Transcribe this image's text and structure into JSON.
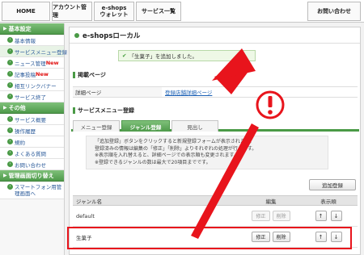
{
  "topnav": {
    "home": "HOME",
    "account": "アカウント管理",
    "eshops_line1": "e-shops",
    "eshops_line2": "ウォレット",
    "service": "サービス一覧",
    "contact": "お問い合わせ"
  },
  "sidebar": {
    "sections": [
      {
        "title": "基本設定",
        "items": [
          {
            "label": "基本情報",
            "new": ""
          },
          {
            "label": "サービスメニュー登録",
            "new": ""
          },
          {
            "label": "ニュース管理",
            "new": "New"
          },
          {
            "label": "記事投稿",
            "new": "New"
          },
          {
            "label": "相互リンクバナー",
            "new": ""
          },
          {
            "label": "サービス終了",
            "new": ""
          }
        ]
      },
      {
        "title": "その他",
        "items": [
          {
            "label": "サービス概要",
            "new": ""
          },
          {
            "label": "操作履歴",
            "new": ""
          },
          {
            "label": "規約",
            "new": ""
          },
          {
            "label": "よくある質問",
            "new": ""
          },
          {
            "label": "お問い合わせ",
            "new": ""
          }
        ]
      },
      {
        "title": "管理画面切り替え",
        "items": [
          {
            "label": "スマートフォン用管理画面へ",
            "new": ""
          }
        ]
      }
    ]
  },
  "main": {
    "title": "e-shopsローカル",
    "notice": "「生菓子」を追加しました。",
    "section_published": "掲載ページ",
    "detail_label": "詳細ページ",
    "detail_link": "登録店舗詳細ページ",
    "section_menu": "サービスメニュー登録",
    "tabs": [
      "メニュー登録",
      "ジャンル登録",
      "見出し"
    ],
    "info_lines": [
      "「追加登録」ボタンをクリックすると新規登録フォームが表示されます。",
      "登録済みの情報は編集の「修正」「削除」よりそれぞれの処理が行えます。",
      "※表示順を入れ替えると、詳細ページでの表示順も変更されます。",
      "※登録できるジャンルの数は最大で20項目までです。"
    ],
    "add_button": "追加登録",
    "table": {
      "headers": {
        "name": "ジャンル名",
        "edit": "編集",
        "order": "表示順"
      },
      "rows": [
        {
          "name": "default",
          "edit": "修正",
          "delete": "削除",
          "up": "↑",
          "down": "↓"
        },
        {
          "name": "生菓子",
          "edit": "修正",
          "delete": "削除",
          "up": "↑",
          "down": "↓"
        }
      ]
    }
  },
  "colors": {
    "accent_green": "#4a9a46",
    "annotation_red": "#e8141c"
  }
}
